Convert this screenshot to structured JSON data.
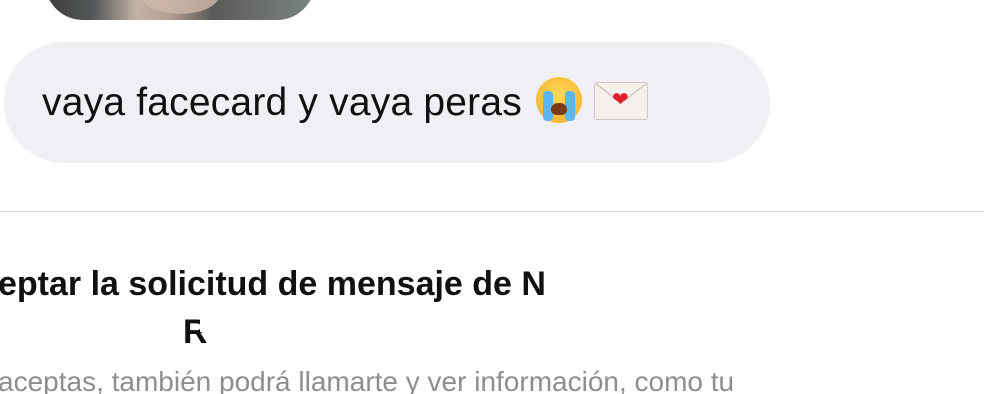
{
  "message": {
    "text": "vaya facecard y vaya peras",
    "emojis": [
      "loudly-crying-face-emoji",
      "love-letter-emoji"
    ]
  },
  "request": {
    "title_line1": "eptar la solicitud de mensaje de N",
    "title_line2": "R",
    "description": "aceptas, también podrá llamarte y ver información, como tu"
  },
  "colors": {
    "bubble_bg": "#efeff4",
    "text": "#111111",
    "secondary_text": "#8e8e8e",
    "divider": "#dbdbdb"
  }
}
